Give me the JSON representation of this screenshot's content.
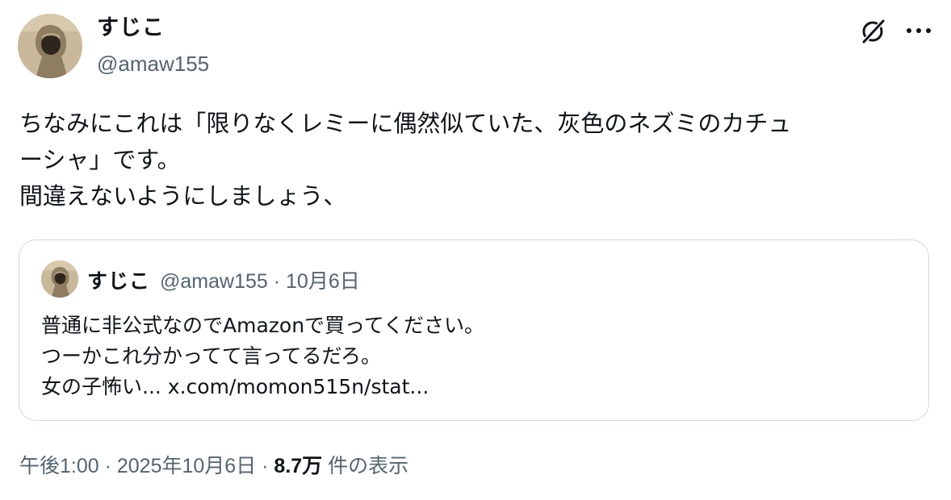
{
  "tweet": {
    "author": {
      "display_name": "すじこ",
      "handle": "@amaw155"
    },
    "text": "ちなみにこれは「限りなくレミーに偶然似ていた、灰色のネズミのカチュ\nーシャ」です。\n間違えないようにしましょう、",
    "icons": {
      "grok": "grok-icon",
      "more": "more-options-icon"
    },
    "quote": {
      "display_name": "すじこ",
      "meta": "@amaw155 · 10月6日",
      "text": "普通に非公式なのでAmazonで買ってください。\nつーかこれ分かってて言ってるだろ。\n女の子怖い... ",
      "link": "x.com/momon515n/stat..."
    },
    "footer": {
      "time_date": "午後1:00 · 2025年10月6日 · ",
      "views_count": "8.7万",
      "views_label": " 件の表示"
    }
  }
}
